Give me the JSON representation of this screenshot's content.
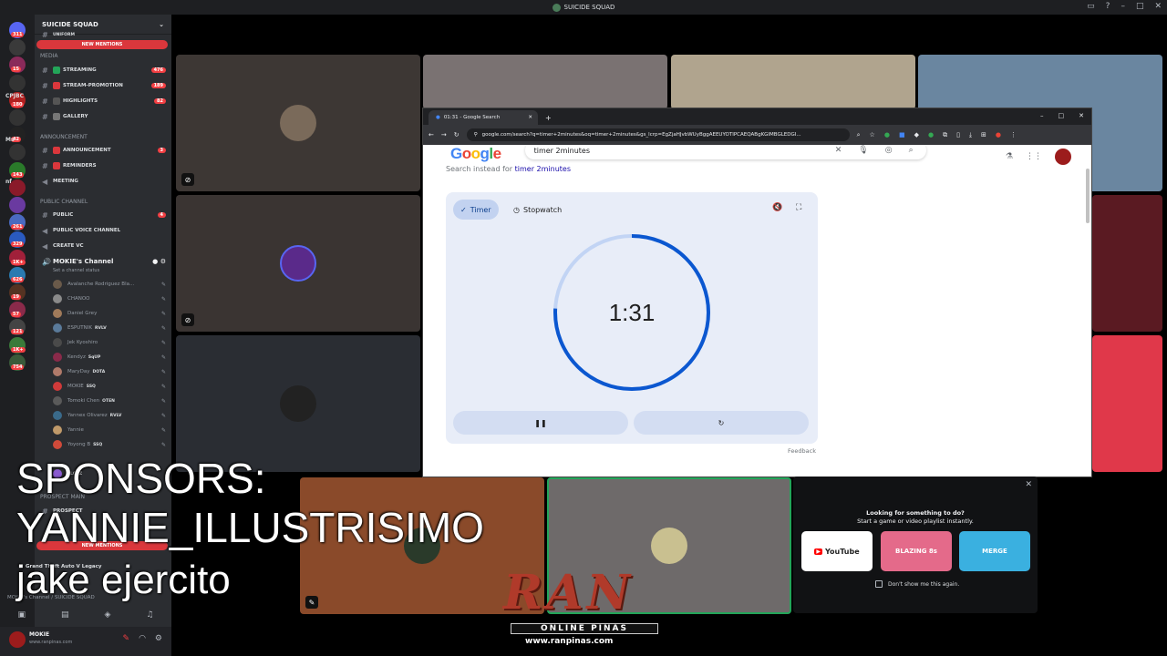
{
  "window": {
    "title": "SUICIDE SQUAD"
  },
  "rail": {
    "servers": [
      {
        "badge": "311",
        "color": "#5865f2"
      },
      {
        "badge": "",
        "color": "#3a3a3a"
      },
      {
        "badge": "15",
        "color": "#8a2a5a"
      },
      {
        "badge": "",
        "color": "#333"
      },
      {
        "badge": "180",
        "color": "#b02020"
      },
      {
        "badge": "",
        "color": "#333"
      },
      {
        "badge": "42",
        "color": "#222"
      },
      {
        "badge": "",
        "color": "#333"
      },
      {
        "badge": "143",
        "color": "#2a7a2a"
      },
      {
        "badge": "",
        "color": "#8a1a2a"
      },
      {
        "badge": "",
        "color": "#6a3aa0"
      },
      {
        "badge": "261",
        "color": "#4a6ac0"
      },
      {
        "badge": "329",
        "color": "#2a5ac0"
      },
      {
        "badge": "1K+",
        "color": "#a0203a"
      },
      {
        "badge": "626",
        "color": "#2a7ab0"
      },
      {
        "badge": "19",
        "color": "#553322"
      },
      {
        "badge": "57",
        "color": "#8a2a4a"
      },
      {
        "badge": "121",
        "color": "#444"
      },
      {
        "badge": "1K+",
        "color": "#3a7a3a"
      },
      {
        "badge": "754",
        "color": "#3a5a3a"
      }
    ],
    "labels": [
      "CPJBC",
      "Ms",
      "nf"
    ]
  },
  "sidebar": {
    "server_name": "SUICIDE SQUAD",
    "new_mentions": "NEW MENTIONS",
    "top_channel": "UNIFORM",
    "categories": {
      "media": "MEDIA",
      "announcement": "ANNOUNCEMENT",
      "public": "PUBLIC CHANNEL",
      "prospect": "PROSPECT MAIN"
    },
    "media_channels": [
      {
        "name": "STREAMING",
        "count": "476",
        "color": "#23a559"
      },
      {
        "name": "STREAM-PROMOTION",
        "count": "189",
        "color": "#da373c"
      },
      {
        "name": "HIGHLIGHTS",
        "count": "82",
        "color": "#555"
      },
      {
        "name": "GALLERY",
        "count": "",
        "color": "#777"
      }
    ],
    "announce_channels": [
      {
        "name": "ANNOUNCEMENT",
        "count": "3",
        "color": "#da373c"
      },
      {
        "name": "REMINDERS",
        "count": "",
        "color": "#da373c"
      },
      {
        "name": "MEETING",
        "count": "",
        "color": ""
      }
    ],
    "public_channels": [
      {
        "name": "PUBLIC",
        "count": "4"
      },
      {
        "name": "PUBLIC VOICE CHANNEL",
        "count": ""
      },
      {
        "name": "CREATE VC",
        "count": ""
      }
    ],
    "voice_channel": {
      "name": "MOKIE's Channel",
      "status": "Set a channel status"
    },
    "voice_users": [
      {
        "name": "Avalanche Rodriguez Bla...",
        "tag": ""
      },
      {
        "name": "CHANOO",
        "tag": ""
      },
      {
        "name": "Daniel Grey",
        "tag": ""
      },
      {
        "name": "ESPUTNIK",
        "tag": "RVLV"
      },
      {
        "name": "Jek Kyoshiro",
        "tag": ""
      },
      {
        "name": "Kendyz",
        "tag": "SqUP"
      },
      {
        "name": "MaryDay",
        "tag": "DOTA"
      },
      {
        "name": "MOKIE",
        "tag": "SSQ"
      },
      {
        "name": "Tomoki Chen",
        "tag": "OTEN"
      },
      {
        "name": "Yannex Olivarez",
        "tag": "RVLV"
      },
      {
        "name": "Yannie",
        "tag": ""
      },
      {
        "name": "Yoyong B",
        "tag": "SSQ"
      }
    ],
    "partial_tag": "LOPZ",
    "prospect_channel": "PROSPECT",
    "voice_status": {
      "game": "Grand Theft Auto V Legacy",
      "location": "MOKIE's Channel / SUICIDE SQUAD"
    },
    "user": {
      "name": "MOKIE",
      "sub": "www.ranpinas.com"
    }
  },
  "browser": {
    "tab_title": "01:31 - Google Search",
    "url": "google.com/search?q=timer+2minutes&oq=timer+2minutes&gs_lcrp=EgZjaHJvbWUyBggAEEUYOTIPCAEQABgKGIMBGLEDGI...",
    "query": "timer 2minutes",
    "search_instead_prefix": "Search instead for",
    "search_instead_link": "timer 2minutes",
    "timer_tab": "Timer",
    "stopwatch_tab": "Stopwatch",
    "time": "1:31",
    "progress": 0.758,
    "feedback": "Feedback",
    "logo_letters": [
      "G",
      "o",
      "o",
      "g",
      "l",
      "e"
    ]
  },
  "popup": {
    "line1": "Looking for something to do?",
    "line2": "Start a game or video playlist instantly.",
    "youtube": "YouTube",
    "game1": "BLAZING 8s",
    "game2": "MERGE",
    "dont_show": "Don't show me this again."
  },
  "overlay": {
    "sponsors": "SPONSORS:",
    "name1": "YANNIE_ILLUSTRISIMO",
    "name2": "jake ejercito"
  },
  "logo": {
    "main": "RAN",
    "sub": "ONLINE PINAS",
    "url": "www.ranpinas.com"
  },
  "colors": {
    "accent": "#0b57d0",
    "track": "#c2d4f4",
    "mention": "#da373c"
  }
}
